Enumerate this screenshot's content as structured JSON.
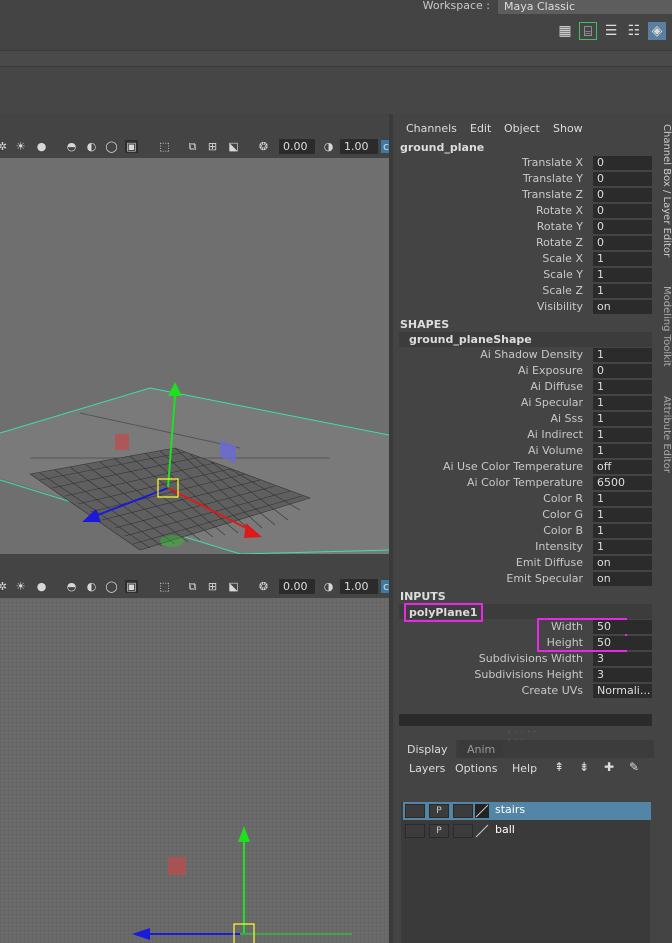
{
  "workspace": {
    "label": "Workspace :",
    "value": "Maya Classic"
  },
  "viewport_top": {
    "field1": "0.00",
    "field2": "1.00"
  },
  "viewport_bottom": {
    "field1": "0.00",
    "field2": "1.00"
  },
  "channel_box": {
    "menu": [
      "Channels",
      "Edit",
      "Object",
      "Show"
    ],
    "node": "ground_plane",
    "transform_attrs": [
      {
        "label": "Translate X",
        "value": "0"
      },
      {
        "label": "Translate Y",
        "value": "0"
      },
      {
        "label": "Translate Z",
        "value": "0"
      },
      {
        "label": "Rotate X",
        "value": "0"
      },
      {
        "label": "Rotate Y",
        "value": "0"
      },
      {
        "label": "Rotate Z",
        "value": "0"
      },
      {
        "label": "Scale X",
        "value": "1"
      },
      {
        "label": "Scale Y",
        "value": "1"
      },
      {
        "label": "Scale Z",
        "value": "1"
      },
      {
        "label": "Visibility",
        "value": "on"
      }
    ],
    "shapes_header": "SHAPES",
    "shape_node": "ground_planeShape",
    "shape_attrs": [
      {
        "label": "Ai Shadow Density",
        "value": "1"
      },
      {
        "label": "Ai Exposure",
        "value": "0"
      },
      {
        "label": "Ai Diffuse",
        "value": "1"
      },
      {
        "label": "Ai Specular",
        "value": "1"
      },
      {
        "label": "Ai Sss",
        "value": "1"
      },
      {
        "label": "Ai Indirect",
        "value": "1"
      },
      {
        "label": "Ai Volume",
        "value": "1"
      },
      {
        "label": "Ai Use Color Temperature",
        "value": "off"
      },
      {
        "label": "Ai Color Temperature",
        "value": "6500"
      },
      {
        "label": "Color R",
        "value": "1"
      },
      {
        "label": "Color G",
        "value": "1"
      },
      {
        "label": "Color B",
        "value": "1"
      },
      {
        "label": "Intensity",
        "value": "1"
      },
      {
        "label": "Emit Diffuse",
        "value": "on"
      },
      {
        "label": "Emit Specular",
        "value": "on"
      }
    ],
    "inputs_header": "INPUTS",
    "input_node": "polyPlane1",
    "input_attrs": [
      {
        "label": "Width",
        "value": "50"
      },
      {
        "label": "Height",
        "value": "50"
      },
      {
        "label": "Subdivisions Width",
        "value": "3"
      },
      {
        "label": "Subdivisions Height",
        "value": "3"
      },
      {
        "label": "Create UVs",
        "value": "Normali..."
      }
    ],
    "highlight_color": "#e629e6"
  },
  "layer_editor": {
    "tabs": [
      "Display",
      "Anim"
    ],
    "menu": [
      "Layers",
      "Options",
      "Help"
    ],
    "layers": [
      {
        "name": "stairs",
        "p": "P",
        "selected": true
      },
      {
        "name": "ball",
        "p": "P",
        "selected": false
      }
    ]
  },
  "side_tabs": [
    "Channel Box / Layer Editor",
    "Modeling Toolkit",
    "Attribute Editor"
  ],
  "colors": {
    "panel": "#444444",
    "field": "#2b2b2b",
    "selected_layer": "#5285a6",
    "grid_green": "#3ee0a0"
  }
}
